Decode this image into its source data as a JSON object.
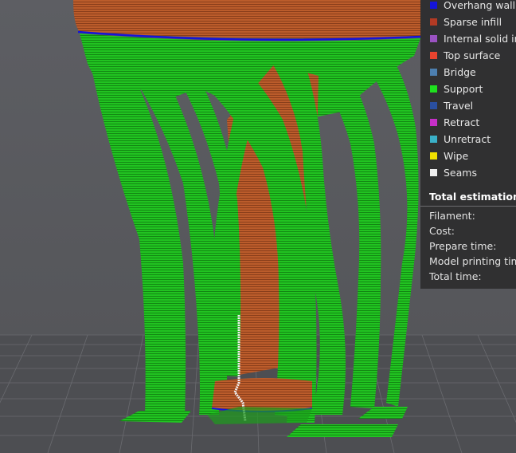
{
  "legend": {
    "items": [
      {
        "label": "Overhang wall",
        "color": "#1515d8"
      },
      {
        "label": "Sparse infill",
        "color": "#b23a24"
      },
      {
        "label": "Internal solid infill",
        "color": "#9a52c2"
      },
      {
        "label": "Top surface",
        "color": "#e8432e"
      },
      {
        "label": "Bridge",
        "color": "#4d7fb0"
      },
      {
        "label": "Support",
        "color": "#1ee01e"
      },
      {
        "label": "Travel",
        "color": "#2a4fa0"
      },
      {
        "label": "Retract",
        "color": "#c62fc8"
      },
      {
        "label": "Unretract",
        "color": "#3ab0c8"
      },
      {
        "label": "Wipe",
        "color": "#f0e000"
      },
      {
        "label": "Seams",
        "color": "#eeeeee"
      }
    ]
  },
  "estimation": {
    "title": "Total estimation",
    "rows": [
      {
        "label": "Filament:"
      },
      {
        "label": "Cost:"
      },
      {
        "label": "Prepare time:"
      },
      {
        "label": "Model printing time:"
      },
      {
        "label": "Total time:"
      }
    ]
  },
  "colors": {
    "support": "#1ec41e",
    "model": "#b85a2a",
    "overhang_wall": "#1515d8",
    "seam": "#eeeeee",
    "bed": "#4c4c50",
    "background": "#5a5b5f"
  }
}
